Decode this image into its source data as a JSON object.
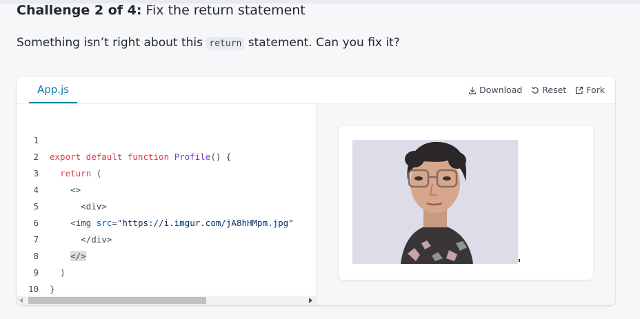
{
  "challenge": {
    "prefix": "Challenge 2 of 4:",
    "name": "Fix the return statement"
  },
  "intro": {
    "before": "Something isn’t right about this ",
    "code": "return",
    "after": " statement. Can you fix it?"
  },
  "sandbox": {
    "file_tab": "App.js",
    "actions": {
      "download": "Download",
      "reset": "Reset",
      "fork": "Fork"
    },
    "colors": {
      "accent": "#087ea4",
      "keyword": "#d73a49",
      "function": "#6f42c1",
      "attribute": "#005cc5",
      "string": "#032f62"
    }
  },
  "code": {
    "line_numbers": [
      "1",
      "2",
      "3",
      "4",
      "5",
      "6",
      "7",
      "8",
      "9",
      "10"
    ],
    "l1": {
      "kw": "export default function",
      "fn": "Profile",
      "rest": "() {"
    },
    "l2": {
      "kw": "return",
      "rest": " ("
    },
    "l3": {
      "tag": "<>"
    },
    "l4": {
      "tag": "<div>"
    },
    "l5": {
      "open": "<img",
      "attr": "src",
      "eq": "=",
      "str": "\"https://i.imgur.com/jA8hHMpm.jpg\""
    },
    "l6": {
      "tag": "</div>"
    },
    "l7": {
      "tag": "</>"
    },
    "l8": {
      "text": ")"
    },
    "l9": {
      "text": "}"
    }
  },
  "preview": {
    "image_alt": "photo of a woman with glasses"
  }
}
